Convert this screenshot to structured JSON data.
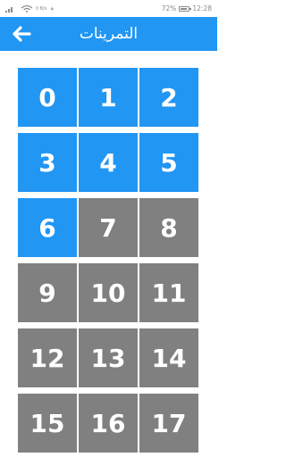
{
  "status_bar": {
    "left_text": "0 B/s",
    "battery_percent": "72%",
    "time": "12:28"
  },
  "header": {
    "title": "التمرينات",
    "back_icon": "arrow-left-icon"
  },
  "colors": {
    "accent": "#2196f3",
    "locked": "#808080",
    "text_on_tile": "#ffffff"
  },
  "exercises": [
    {
      "number": "0",
      "unlocked": true
    },
    {
      "number": "1",
      "unlocked": true
    },
    {
      "number": "2",
      "unlocked": true
    },
    {
      "number": "3",
      "unlocked": true
    },
    {
      "number": "4",
      "unlocked": true
    },
    {
      "number": "5",
      "unlocked": true
    },
    {
      "number": "6",
      "unlocked": true
    },
    {
      "number": "7",
      "unlocked": false
    },
    {
      "number": "8",
      "unlocked": false
    },
    {
      "number": "9",
      "unlocked": false
    },
    {
      "number": "10",
      "unlocked": false
    },
    {
      "number": "11",
      "unlocked": false
    },
    {
      "number": "12",
      "unlocked": false
    },
    {
      "number": "13",
      "unlocked": false
    },
    {
      "number": "14",
      "unlocked": false
    },
    {
      "number": "15",
      "unlocked": false
    },
    {
      "number": "16",
      "unlocked": false
    },
    {
      "number": "17",
      "unlocked": false
    }
  ]
}
